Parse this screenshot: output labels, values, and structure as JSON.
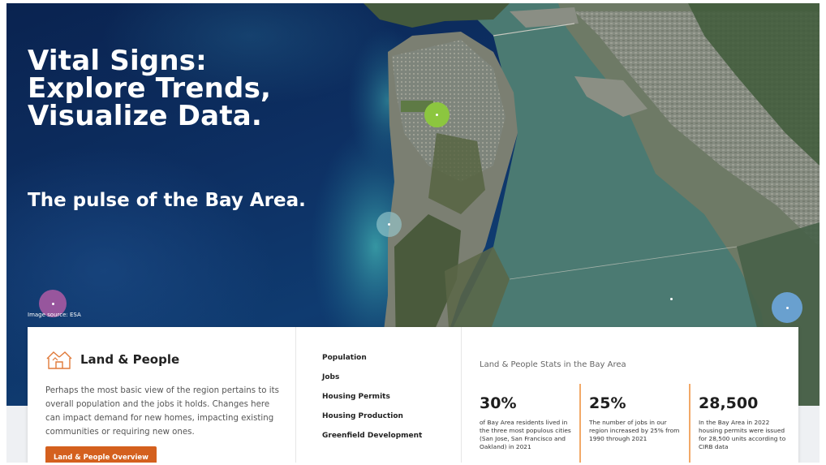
{
  "hero": {
    "title": "Vital Signs:\nExplore Trends,\nVisualize Data.",
    "subtitle": "The pulse of the Bay Area.",
    "image_source": "Image source: ESA"
  },
  "markers": [
    {
      "name": "green",
      "color": "#8cc63f"
    },
    {
      "name": "teal",
      "color": "#96c8cd"
    },
    {
      "name": "pink",
      "color": "#af5aa5"
    },
    {
      "name": "blue",
      "color": "#6eaae6"
    }
  ],
  "card": {
    "section_title": "Land & People",
    "section_icon": "house-icon",
    "description": "Perhaps the most basic view of the region pertains to its overall population and the jobs it holds. Changes here can impact demand for new homes, impacting existing communities or requiring new ones.",
    "overview_button": "Land & People Overview",
    "topics": [
      "Population",
      "Jobs",
      "Housing Permits",
      "Housing Production",
      "Greenfield Development"
    ],
    "stats_heading": "Land & People Stats in the Bay Area",
    "stats": [
      {
        "value": "30%",
        "desc": "of Bay Area residents lived in the three most populous cities (San Jose, San Francisco and Oakland) in 2021"
      },
      {
        "value": "25%",
        "desc": "The number of jobs in our region increased by 25% from 1990 through 2021"
      },
      {
        "value": "28,500",
        "desc": "In the Bay Area in 2022 housing permits were issued for 28,500 units according to CIRB data"
      }
    ]
  },
  "colors": {
    "accent": "#d4601e",
    "stat_divider": "#f2a968",
    "ocean": "#0d2f62",
    "bay_water": "#3c6864"
  }
}
